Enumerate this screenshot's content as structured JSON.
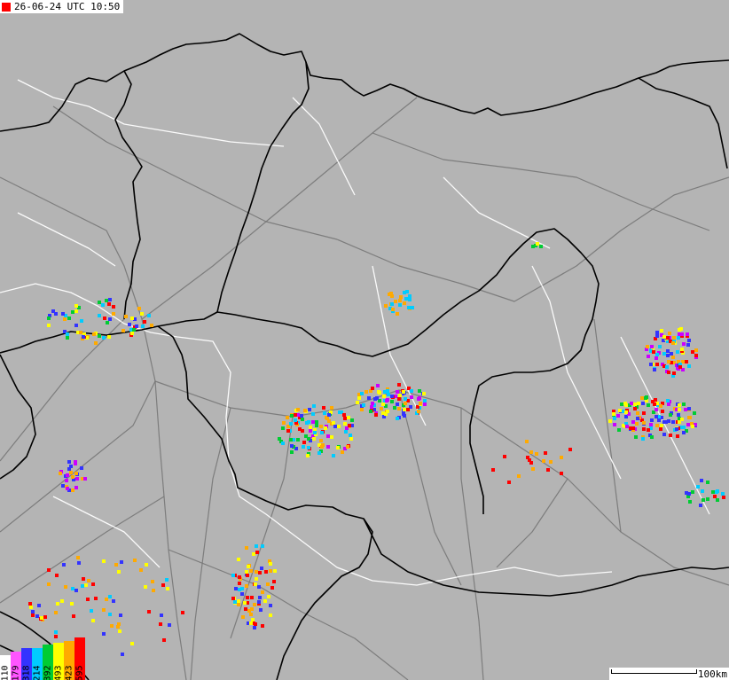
{
  "timestamp": "26-06-24 UTC 10:50",
  "scale_label": "100km",
  "colors": {
    "land": "#b4b4b4",
    "roads": "#777777",
    "rivers": "#ffffff",
    "borders": "#000000",
    "accent": "#ff0000"
  },
  "legend": [
    {
      "label": "110",
      "color": "#ffffff"
    },
    {
      "label": "179",
      "color": "#ff55ff"
    },
    {
      "label": "318",
      "color": "#3333ff"
    },
    {
      "label": "214",
      "color": "#00ccff"
    },
    {
      "label": "392",
      "color": "#00cc33"
    },
    {
      "label": "493",
      "color": "#ffff00"
    },
    {
      "label": "423",
      "color": "#ffaa00"
    },
    {
      "label": "595",
      "color": "#ff0000"
    }
  ],
  "strike_clusters": [
    {
      "region": "north-center",
      "palette": [
        "#ffaa00",
        "#00ccff"
      ]
    },
    {
      "region": "northeast-small",
      "palette": [
        "#ffff00",
        "#00cc33"
      ]
    },
    {
      "region": "east-upper",
      "palette": [
        "#3333ff",
        "#cc00ff",
        "#ff0000",
        "#ffaa00",
        "#ffff00",
        "#00ccff"
      ]
    },
    {
      "region": "east-lower",
      "palette": [
        "#00ccff",
        "#3333ff",
        "#00cc33",
        "#ffff00",
        "#ffaa00",
        "#ff0000",
        "#cc00ff"
      ]
    },
    {
      "region": "center",
      "palette": [
        "#ff0000",
        "#ffff00",
        "#00cc33",
        "#00ccff",
        "#3333ff",
        "#ffaa00",
        "#cc00ff"
      ]
    },
    {
      "region": "center-west",
      "palette": [
        "#ffaa00",
        "#ffff00",
        "#ff0000",
        "#00cc33",
        "#3333ff",
        "#cc00ff",
        "#00ccff"
      ]
    },
    {
      "region": "northwest",
      "palette": [
        "#ffff00",
        "#ffaa00",
        "#ff0000",
        "#00ccff",
        "#3333ff",
        "#00cc33"
      ]
    },
    {
      "region": "west",
      "palette": [
        "#cc00ff",
        "#3333ff",
        "#ffaa00"
      ]
    },
    {
      "region": "southwest",
      "palette": [
        "#ff0000",
        "#ffff00",
        "#00ccff",
        "#ffaa00",
        "#3333ff"
      ]
    },
    {
      "region": "south",
      "palette": [
        "#ff0000",
        "#ffff00",
        "#00ccff",
        "#3333ff",
        "#ffaa00"
      ]
    },
    {
      "region": "southeast",
      "palette": [
        "#00cc33",
        "#00ccff",
        "#3333ff",
        "#ffaa00",
        "#ff0000"
      ]
    },
    {
      "region": "east-scattered",
      "palette": [
        "#ff0000",
        "#ffaa00"
      ]
    }
  ]
}
